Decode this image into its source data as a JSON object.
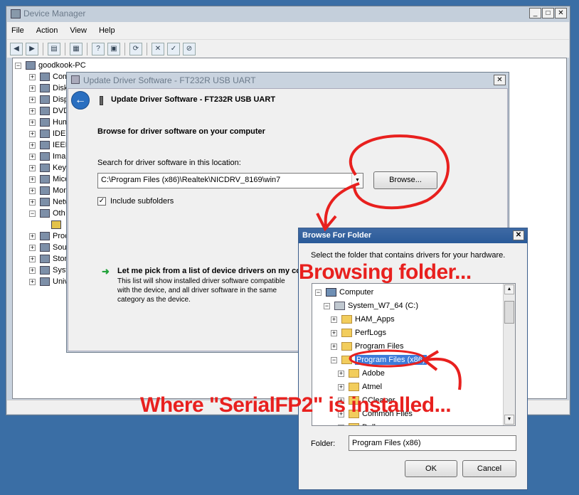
{
  "device_manager": {
    "title": "Device Manager",
    "menu": [
      "File",
      "Action",
      "View",
      "Help"
    ],
    "toolbar_icons": [
      "back-icon",
      "forward-icon",
      "properties-icon",
      "show-hide-icon",
      "help-icon",
      "scan-icon",
      "update-driver-icon",
      "uninstall-icon",
      "enable-icon"
    ],
    "root": "goodkook-PC",
    "tree_items": [
      "Com",
      "Disk",
      "Disp",
      "DVD",
      "Hum",
      "IDE",
      "IEEE",
      "Ima",
      "Key",
      "Mice",
      "Mon",
      "Netw",
      "Oth",
      "",
      "Proc",
      "Sou",
      "Stor",
      "Syst",
      "Univ"
    ]
  },
  "update_driver": {
    "title": "Update Driver Software - FT232R USB UART",
    "header": "Update Driver Software - FT232R USB UART",
    "heading": "Browse for driver software on your computer",
    "search_label": "Search for driver software in this location:",
    "path": "C:\\Program Files (x86)\\Realtek\\NICDRV_8169\\win7",
    "browse_label": "Browse...",
    "include_subfolders": "Include subfolders",
    "pick_label": "Let me pick from a list of device drivers on my computer",
    "pick_desc": "This list will show installed driver software compatible with the device, and all driver software in the same category as the device."
  },
  "browse_folder": {
    "title": "Browse For Folder",
    "description": "Select the folder that contains drivers for your hardware.",
    "tree": [
      {
        "label": "Computer",
        "level": 0,
        "toggle": "−",
        "icon": "computer"
      },
      {
        "label": "System_W7_64 (C:)",
        "level": 1,
        "toggle": "−",
        "icon": "drive"
      },
      {
        "label": "HAM_Apps",
        "level": 2,
        "toggle": "+",
        "icon": "folder"
      },
      {
        "label": "PerfLogs",
        "level": 2,
        "toggle": "+",
        "icon": "folder"
      },
      {
        "label": "Program Files",
        "level": 2,
        "toggle": "+",
        "icon": "folder"
      },
      {
        "label": "Program Files (x86)",
        "level": 2,
        "toggle": "−",
        "icon": "folder",
        "selected": true
      },
      {
        "label": "Adobe",
        "level": 3,
        "toggle": "+",
        "icon": "folder"
      },
      {
        "label": "Atmel",
        "level": 3,
        "toggle": "+",
        "icon": "folder"
      },
      {
        "label": "CCleaner",
        "level": 3,
        "toggle": "+",
        "icon": "folder"
      },
      {
        "label": "Common Files",
        "level": 3,
        "toggle": "+",
        "icon": "folder"
      },
      {
        "label": "Dell",
        "level": 3,
        "toggle": "+",
        "icon": "folder"
      }
    ],
    "folder_label": "Folder:",
    "folder_value": "Program Files (x86)",
    "ok_label": "OK",
    "cancel_label": "Cancel"
  },
  "annotations": {
    "browsing": "Browsing folder...",
    "where": "Where \"SerialFP2\" is installed...",
    "color": "#e8201e"
  }
}
